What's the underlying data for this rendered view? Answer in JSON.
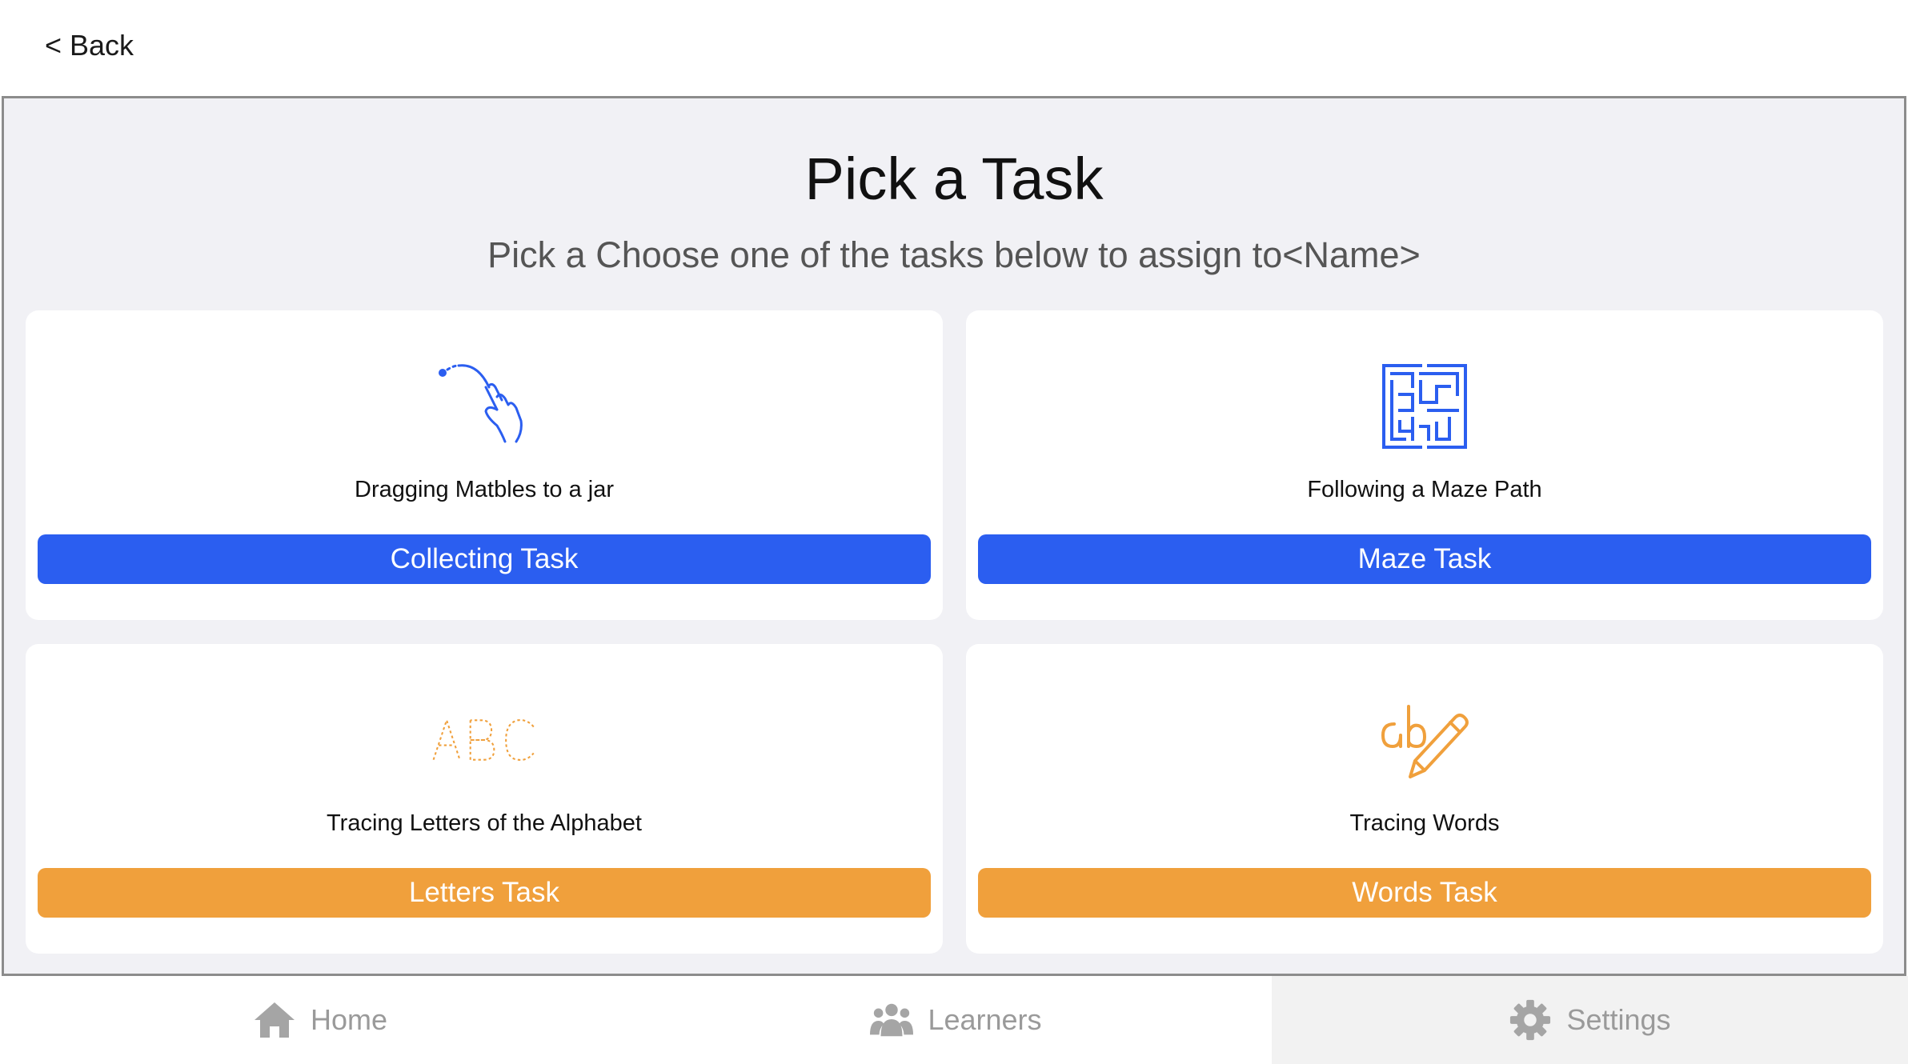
{
  "header": {
    "back_label": "< Back"
  },
  "main": {
    "title": "Pick a Task",
    "subtitle": "Pick a Choose one of the tasks below to assign to<Name>"
  },
  "tasks": [
    {
      "description": "Dragging Matbles to a jar",
      "button_label": "Collecting Task",
      "icon": "drag-gesture-icon",
      "color": "#2b5ef0"
    },
    {
      "description": "Following a Maze Path",
      "button_label": "Maze Task",
      "icon": "maze-icon",
      "color": "#2b5ef0"
    },
    {
      "description": "Tracing Letters of the Alphabet",
      "button_label": "Letters Task",
      "icon": "abc-tracing-icon",
      "color": "#f0a03c"
    },
    {
      "description": "Tracing Words",
      "button_label": "Words Task",
      "icon": "ab-pencil-icon",
      "color": "#f0a03c"
    }
  ],
  "tabbar": {
    "items": [
      {
        "label": "Home",
        "icon": "home-icon"
      },
      {
        "label": "Learners",
        "icon": "learners-icon"
      },
      {
        "label": "Settings",
        "icon": "gear-icon",
        "selected": true
      }
    ]
  },
  "colors": {
    "primary_blue": "#2b5ef0",
    "accent_orange": "#f0a03c",
    "panel_bg": "#f1f1f5",
    "tab_gray": "#9a9a9a"
  }
}
